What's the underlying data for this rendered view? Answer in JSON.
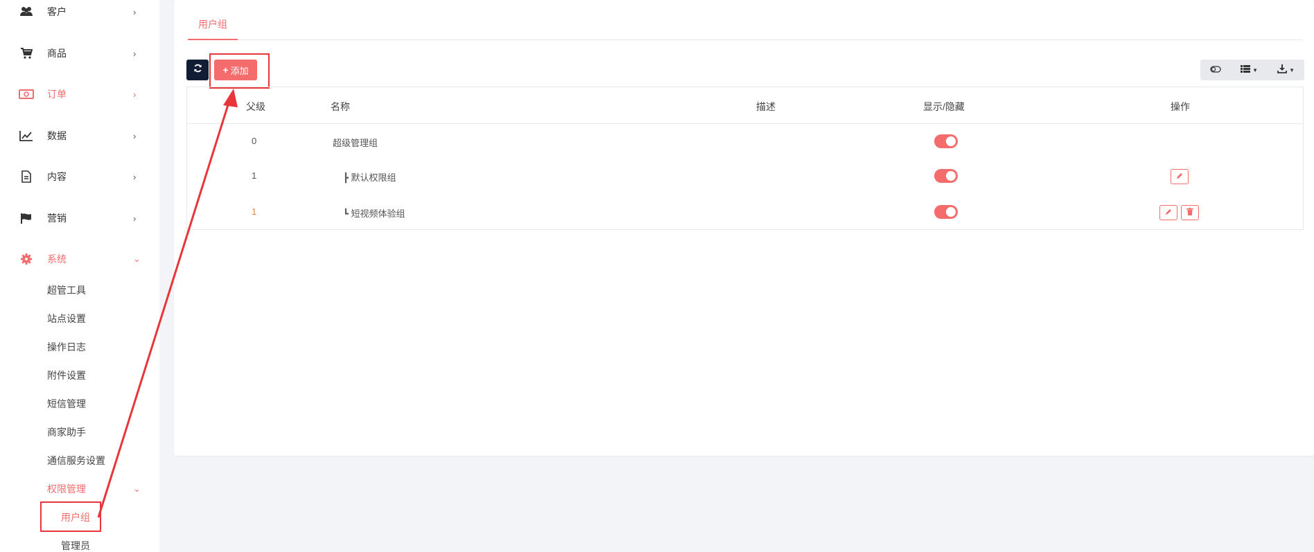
{
  "sidebar": {
    "menu": [
      {
        "label": "客户",
        "icon": "users-icon",
        "chevron": "›"
      },
      {
        "label": "商品",
        "icon": "cart-icon",
        "chevron": "›"
      },
      {
        "label": "订单",
        "icon": "money-icon",
        "chevron": "›"
      },
      {
        "label": "数据",
        "icon": "chart-line-icon",
        "chevron": "›"
      },
      {
        "label": "内容",
        "icon": "document-icon",
        "chevron": "›"
      },
      {
        "label": "营销",
        "icon": "flag-icon",
        "chevron": "›"
      },
      {
        "label": "系统",
        "icon": "gear-icon",
        "chevron": "⌄"
      }
    ],
    "system_sub": [
      "超管工具",
      "站点设置",
      "操作日志",
      "附件设置",
      "短信管理",
      "商家助手",
      "通信服务设置",
      "权限管理"
    ],
    "permission_sub": [
      "用户组",
      "管理员"
    ],
    "permission_chevron": "⌄"
  },
  "tabs": [
    {
      "label": "用户组"
    }
  ],
  "toolbar": {
    "add_label": "添加",
    "add_plus": "+"
  },
  "table": {
    "headers": [
      "父级",
      "名称",
      "描述",
      "显示/隐藏",
      "操作"
    ],
    "rows": [
      {
        "parent": "0",
        "name": "超级管理组",
        "description": "",
        "visible": true,
        "actions": []
      },
      {
        "parent": "1",
        "name": "┣ 默认权限组",
        "description": "",
        "visible": true,
        "actions": [
          "edit"
        ]
      },
      {
        "parent": "1",
        "name": "┗ 短视频体验组",
        "description": "",
        "visible": true,
        "actions": [
          "edit",
          "delete"
        ]
      }
    ]
  },
  "colors": {
    "accent": "#f56c6c",
    "dark_button": "#111d35",
    "annotation": "#e8353a"
  }
}
